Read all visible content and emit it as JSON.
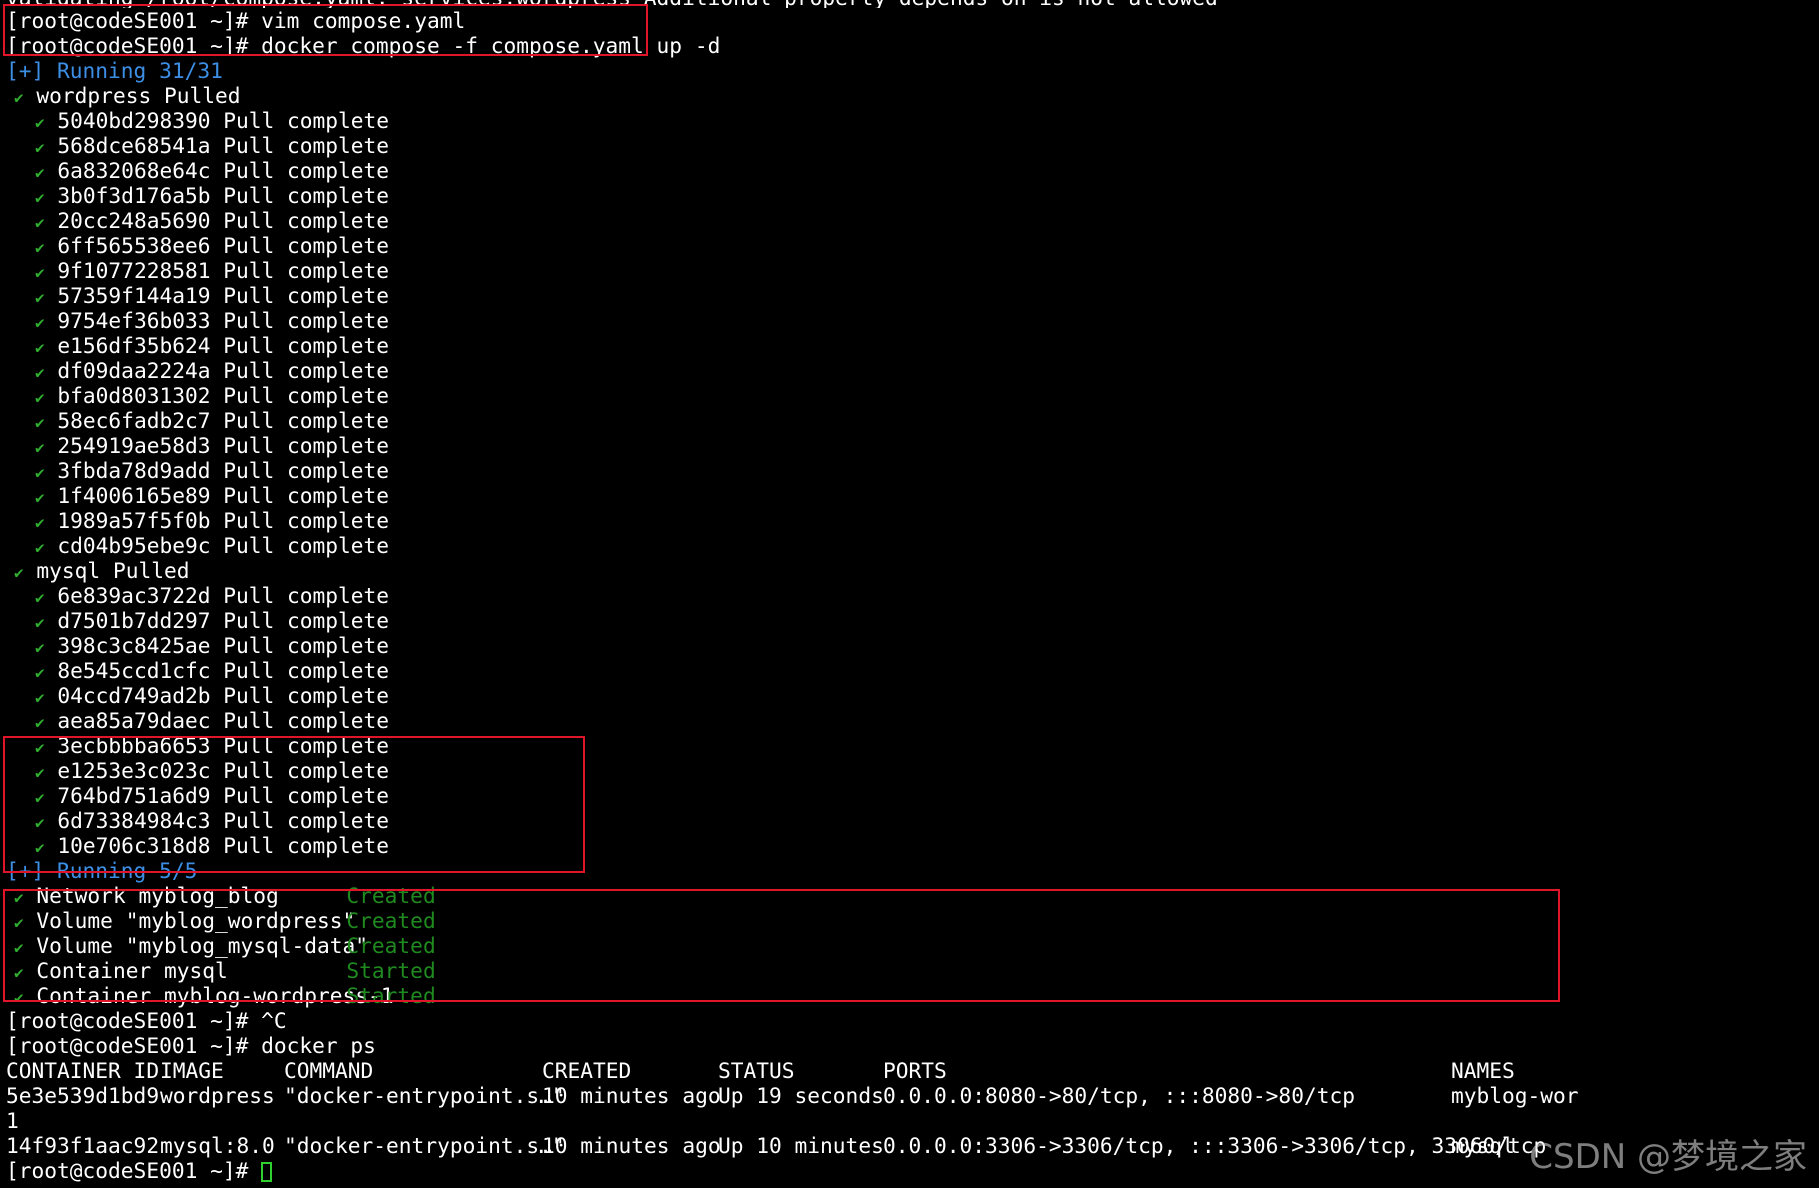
{
  "colors": {
    "background": "#000000",
    "text": "#ffffff",
    "running": "#3d8fe6",
    "check": "#2fae2f",
    "status": "#1f8a1f",
    "highlight_box": "#e0152a",
    "cursor": "#2fcf2f"
  },
  "top_partial": "validating /root/compose.yaml: services.wordpress Additional property depends_on is not allowed",
  "commands": {
    "vim": "[root@codeSE001 ~]# vim compose.yaml",
    "compose_up": "[root@codeSE001 ~]# docker compose -f compose.yaml up -d",
    "ctrl_c": "[root@codeSE001 ~]# ^C",
    "docker_ps": "[root@codeSE001 ~]# docker ps",
    "final_prompt": "[root@codeSE001 ~]# "
  },
  "pull": {
    "running": "[+] Running 31/31",
    "check_icon": "✔",
    "wordpress_header": "wordpress Pulled",
    "wordpress_layers": [
      "5040bd298390 Pull complete",
      "568dce68541a Pull complete",
      "6a832068e64c Pull complete",
      "3b0f3d176a5b Pull complete",
      "20cc248a5690 Pull complete",
      "6ff565538ee6 Pull complete",
      "9f1077228581 Pull complete",
      "57359f144a19 Pull complete",
      "9754ef36b033 Pull complete",
      "e156df35b624 Pull complete",
      "df09daa2224a Pull complete",
      "bfa0d8031302 Pull complete",
      "58ec6fadb2c7 Pull complete",
      "254919ae58d3 Pull complete",
      "3fbda78d9add Pull complete",
      "1f4006165e89 Pull complete",
      "1989a57f5f0b Pull complete",
      "cd04b95ebe9c Pull complete"
    ],
    "mysql_header": "mysql Pulled",
    "mysql_layers": [
      "6e839ac3722d Pull complete",
      "d7501b7dd297 Pull complete",
      "398c3c8425ae Pull complete",
      "8e545ccd1cfc Pull complete",
      "04ccd749ad2b Pull complete",
      "aea85a79daec Pull complete",
      "3ecbbbba6653 Pull complete",
      "e1253e3c023c Pull complete",
      "764bd751a6d9 Pull complete",
      "6d73384984c3 Pull complete",
      "10e706c318d8 Pull complete"
    ]
  },
  "create": {
    "running": "[+] Running 5/5",
    "items": [
      {
        "name": "Network myblog_blog",
        "status": "Created"
      },
      {
        "name": "Volume \"myblog_wordpress\"",
        "status": "Created"
      },
      {
        "name": "Volume \"myblog_mysql-data\"",
        "status": "Created"
      },
      {
        "name": "Container mysql",
        "status": "Started"
      },
      {
        "name": "Container myblog-wordpress-1",
        "status": "Started"
      }
    ]
  },
  "ps": {
    "headers": [
      "CONTAINER ID",
      "IMAGE",
      "COMMAND",
      "CREATED",
      "STATUS",
      "PORTS",
      "NAMES"
    ],
    "rows": [
      {
        "id": "5e3e539d1bd9",
        "image": "wordpress",
        "command": "\"docker-entrypoint.s…\"",
        "created": "10 minutes ago",
        "status": "Up 19 seconds",
        "ports": "0.0.0.0:8080->80/tcp, :::8080->80/tcp",
        "names": "myblog-wor",
        "wrap": "1"
      },
      {
        "id": "14f93f1aac92",
        "image": "mysql:8.0",
        "command": "\"docker-entrypoint.s…\"",
        "created": "10 minutes ago",
        "status": "Up 10 minutes",
        "ports": "0.0.0.0:3306->3306/tcp, :::3306->3306/tcp, 33060/tcp",
        "names": "mysql"
      }
    ]
  },
  "watermark": "CSDN @梦境之家"
}
